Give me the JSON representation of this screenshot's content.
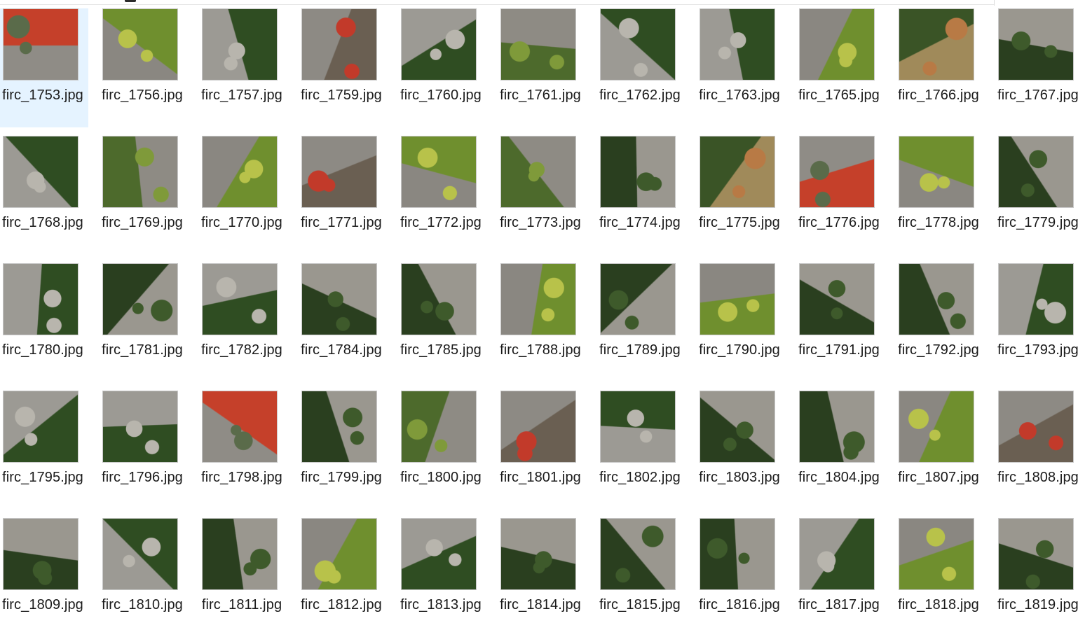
{
  "files": [
    {
      "name": "firc_1753.jpg",
      "palette": "playground",
      "selected": true
    },
    {
      "name": "firc_1756.jpg",
      "palette": "treegrass"
    },
    {
      "name": "firc_1757.jpg",
      "palette": "pavement"
    },
    {
      "name": "firc_1759.jpg",
      "palette": "structure"
    },
    {
      "name": "firc_1760.jpg",
      "palette": "pavement"
    },
    {
      "name": "firc_1761.jpg",
      "palette": "tree"
    },
    {
      "name": "firc_1762.jpg",
      "palette": "pavement"
    },
    {
      "name": "firc_1763.jpg",
      "palette": "pavement"
    },
    {
      "name": "firc_1765.jpg",
      "palette": "treegrass"
    },
    {
      "name": "firc_1766.jpg",
      "palette": "autumn"
    },
    {
      "name": "firc_1767.jpg",
      "palette": "grass"
    },
    {
      "name": "firc_1768.jpg",
      "palette": "pavement"
    },
    {
      "name": "firc_1769.jpg",
      "palette": "tree"
    },
    {
      "name": "firc_1770.jpg",
      "palette": "treegrass"
    },
    {
      "name": "firc_1771.jpg",
      "palette": "structure"
    },
    {
      "name": "firc_1772.jpg",
      "palette": "treegrass"
    },
    {
      "name": "firc_1773.jpg",
      "palette": "tree"
    },
    {
      "name": "firc_1774.jpg",
      "palette": "grass"
    },
    {
      "name": "firc_1775.jpg",
      "palette": "autumn"
    },
    {
      "name": "firc_1776.jpg",
      "palette": "playground"
    },
    {
      "name": "firc_1778.jpg",
      "palette": "treegrass"
    },
    {
      "name": "firc_1779.jpg",
      "palette": "grass"
    },
    {
      "name": "firc_1780.jpg",
      "palette": "pavement"
    },
    {
      "name": "firc_1781.jpg",
      "palette": "grass"
    },
    {
      "name": "firc_1782.jpg",
      "palette": "pavement"
    },
    {
      "name": "firc_1784.jpg",
      "palette": "grass"
    },
    {
      "name": "firc_1785.jpg",
      "palette": "grass"
    },
    {
      "name": "firc_1788.jpg",
      "palette": "treegrass"
    },
    {
      "name": "firc_1789.jpg",
      "palette": "grass"
    },
    {
      "name": "firc_1790.jpg",
      "palette": "treegrass"
    },
    {
      "name": "firc_1791.jpg",
      "palette": "grass"
    },
    {
      "name": "firc_1792.jpg",
      "palette": "grass"
    },
    {
      "name": "firc_1793.jpg",
      "palette": "pavement"
    },
    {
      "name": "firc_1795.jpg",
      "palette": "pavement"
    },
    {
      "name": "firc_1796.jpg",
      "palette": "pavement"
    },
    {
      "name": "firc_1798.jpg",
      "palette": "playground"
    },
    {
      "name": "firc_1799.jpg",
      "palette": "grass"
    },
    {
      "name": "firc_1800.jpg",
      "palette": "tree"
    },
    {
      "name": "firc_1801.jpg",
      "palette": "structure"
    },
    {
      "name": "firc_1802.jpg",
      "palette": "pavement"
    },
    {
      "name": "firc_1803.jpg",
      "palette": "grass"
    },
    {
      "name": "firc_1804.jpg",
      "palette": "grass"
    },
    {
      "name": "firc_1807.jpg",
      "palette": "treegrass"
    },
    {
      "name": "firc_1808.jpg",
      "palette": "structure"
    },
    {
      "name": "firc_1809.jpg",
      "palette": "grass"
    },
    {
      "name": "firc_1810.jpg",
      "palette": "pavement"
    },
    {
      "name": "firc_1811.jpg",
      "palette": "grass"
    },
    {
      "name": "firc_1812.jpg",
      "palette": "treegrass"
    },
    {
      "name": "firc_1813.jpg",
      "palette": "pavement"
    },
    {
      "name": "firc_1814.jpg",
      "palette": "grass"
    },
    {
      "name": "firc_1815.jpg",
      "palette": "grass"
    },
    {
      "name": "firc_1816.jpg",
      "palette": "grass"
    },
    {
      "name": "firc_1817.jpg",
      "palette": "pavement"
    },
    {
      "name": "firc_1818.jpg",
      "palette": "treegrass"
    },
    {
      "name": "firc_1819.jpg",
      "palette": "grass"
    }
  ],
  "palettes": {
    "pavement": {
      "base": "#9c9a94",
      "accent": "#2f4d22",
      "hint": "#b8b5ad"
    },
    "grass": {
      "base": "#2a3f1f",
      "accent": "#9a978f",
      "hint": "#3e5a2b"
    },
    "tree": {
      "base": "#4d6a2c",
      "accent": "#8e8b84",
      "hint": "#7f9a3a"
    },
    "treegrass": {
      "base": "#8a8781",
      "accent": "#6f8f2e",
      "hint": "#b8c24a"
    },
    "autumn": {
      "base": "#3a5426",
      "accent": "#a08a5a",
      "hint": "#b87a45"
    },
    "structure": {
      "base": "#8d8a84",
      "accent": "#6a5f52",
      "hint": "#c23a2a"
    },
    "playground": {
      "base": "#8f8c86",
      "accent": "#c5402a",
      "hint": "#5a6b4a"
    }
  }
}
